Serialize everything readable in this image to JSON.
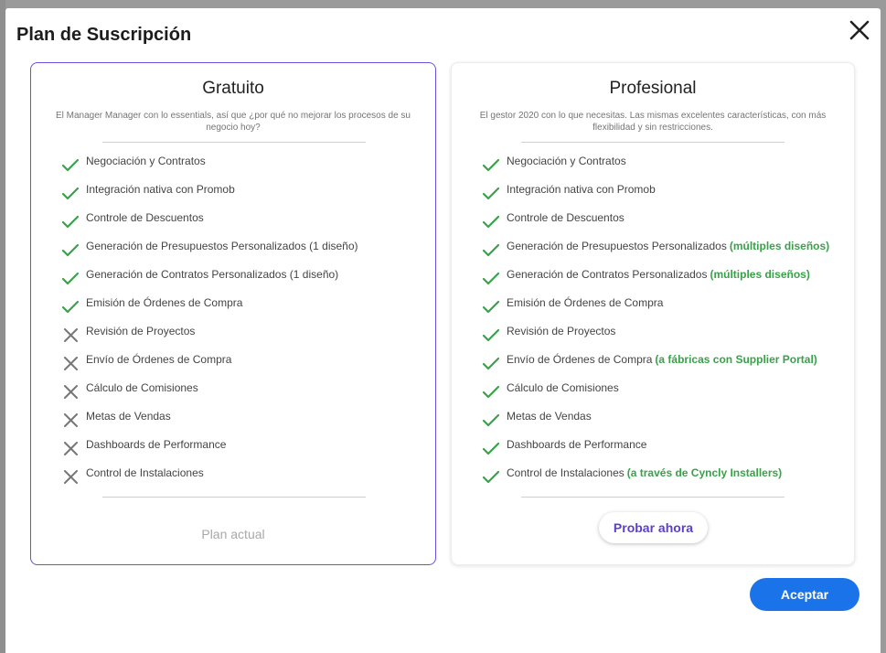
{
  "modal": {
    "title": "Plan de Suscripción",
    "close_icon": "close-icon"
  },
  "colors": {
    "accent_purple": "#6a4fe0",
    "check_green": "#3aa14a",
    "cross_gray": "#777777",
    "primary_blue": "#1a73e8"
  },
  "plans": {
    "free": {
      "title": "Gratuito",
      "description": "El Manager Manager con lo essentials, así que ¿por qué no mejorar los procesos de su negocio hoy?",
      "status": "Plan actual",
      "features": [
        {
          "label": "Negociación y Contratos",
          "included": true,
          "extra": ""
        },
        {
          "label": "Integración nativa con Promob",
          "included": true,
          "extra": ""
        },
        {
          "label": "Controle de Descuentos",
          "included": true,
          "extra": ""
        },
        {
          "label": "Generación de Presupuestos Personalizados (1 diseño)",
          "included": true,
          "extra": ""
        },
        {
          "label": "Generación de Contratos Personalizados (1 diseño)",
          "included": true,
          "extra": ""
        },
        {
          "label": "Emisión de Órdenes de Compra",
          "included": true,
          "extra": ""
        },
        {
          "label": "Revisión de Proyectos",
          "included": false,
          "extra": ""
        },
        {
          "label": "Envío de Órdenes de Compra",
          "included": false,
          "extra": ""
        },
        {
          "label": "Cálculo de Comisiones",
          "included": false,
          "extra": ""
        },
        {
          "label": "Metas de Vendas",
          "included": false,
          "extra": ""
        },
        {
          "label": "Dashboards de Performance",
          "included": false,
          "extra": ""
        },
        {
          "label": "Control de Instalaciones",
          "included": false,
          "extra": ""
        }
      ]
    },
    "pro": {
      "title": "Profesional",
      "description": "El gestor 2020 con lo que necesitas. Las mismas excelentes características, con más flexibilidad y sin restricciones.",
      "button_label": "Probar ahora",
      "features": [
        {
          "label": "Negociación y Contratos",
          "included": true,
          "extra": ""
        },
        {
          "label": "Integración nativa con Promob",
          "included": true,
          "extra": ""
        },
        {
          "label": "Controle de Descuentos",
          "included": true,
          "extra": ""
        },
        {
          "label": "Generación de Presupuestos Personalizados",
          "included": true,
          "extra": "(múltiples diseños)"
        },
        {
          "label": "Generación de Contratos Personalizados",
          "included": true,
          "extra": "(múltiples diseños)"
        },
        {
          "label": "Emisión de Órdenes de Compra",
          "included": true,
          "extra": ""
        },
        {
          "label": "Revisión de Proyectos",
          "included": true,
          "extra": ""
        },
        {
          "label": "Envío de Órdenes de Compra",
          "included": true,
          "extra": "(a fábricas con Supplier Portal)"
        },
        {
          "label": "Cálculo de Comisiones",
          "included": true,
          "extra": ""
        },
        {
          "label": "Metas de Vendas",
          "included": true,
          "extra": ""
        },
        {
          "label": "Dashboards de Performance",
          "included": true,
          "extra": ""
        },
        {
          "label": "Control de Instalaciones",
          "included": true,
          "extra": "(a través de Cyncly Installers)"
        }
      ]
    }
  },
  "footer": {
    "accept_label": "Aceptar"
  }
}
